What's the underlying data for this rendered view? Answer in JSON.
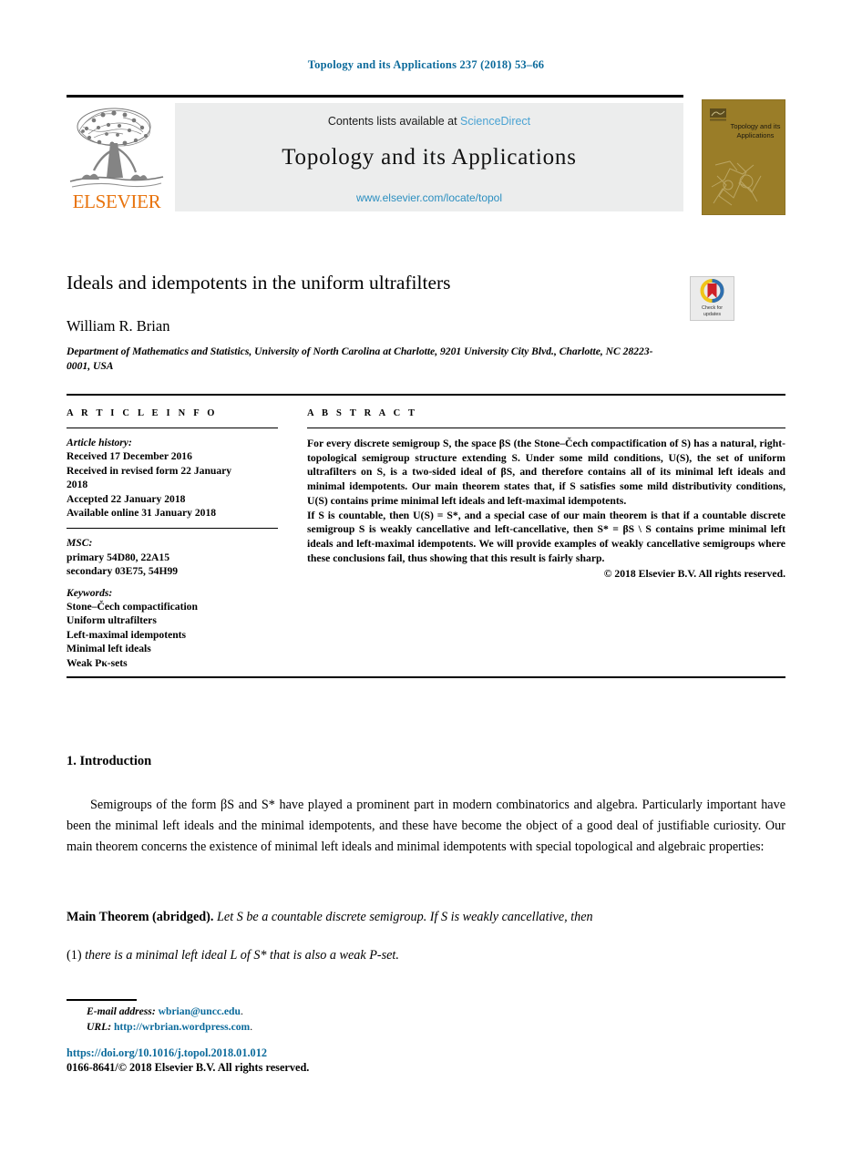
{
  "running_head": "Topology and its Applications 237 (2018) 53–66",
  "masthead": {
    "contents_prefix": "Contents lists available at ",
    "sciencedirect": "ScienceDirect",
    "journal_title": "Topology and its Applications",
    "journal_url": "www.elsevier.com/locate/topol",
    "publisher_wordmark": "ELSEVIER",
    "cover_title": "Topology and its Applications",
    "accent_link_color": "#4ba3d3",
    "elsevier_orange": "#e8730c",
    "cover_background": "#9a7d28"
  },
  "article": {
    "title": "Ideals and idempotents in the uniform ultrafilters",
    "author": "William R. Brian",
    "affiliation": "Department of Mathematics and Statistics, University of North Carolina at Charlotte, 9201 University City Blvd., Charlotte, NC 28223-0001, USA",
    "crossmark_label_line1": "Check for",
    "crossmark_label_line2": "updates"
  },
  "info": {
    "heading": "A R T I C L E   I N F O",
    "history_label": "Article history:",
    "history": [
      "Received 17 December 2016",
      "Received in revised form 22 January",
      "2018",
      "Accepted 22 January 2018",
      "Available online 31 January 2018"
    ],
    "msc_label": "MSC:",
    "msc": [
      "primary 54D80, 22A15",
      "secondary 03E75, 54H99"
    ],
    "keywords_label": "Keywords:",
    "keywords": [
      "Stone–Čech compactification",
      "Uniform ultrafilters",
      "Left-maximal idempotents",
      "Minimal left ideals",
      "Weak Pκ-sets"
    ]
  },
  "abstract": {
    "heading": "A B S T R A C T",
    "paragraph1": "For every discrete semigroup S, the space βS (the Stone–Čech compactification of S) has a natural, right-topological semigroup structure extending S. Under some mild conditions, U(S), the set of uniform ultrafilters on S, is a two-sided ideal of βS, and therefore contains all of its minimal left ideals and minimal idempotents. Our main theorem states that, if S satisfies some mild distributivity conditions, U(S) contains prime minimal left ideals and left-maximal idempotents.",
    "paragraph2": "If S is countable, then U(S) = S*, and a special case of our main theorem is that if a countable discrete semigroup S is weakly cancellative and left-cancellative, then S* = βS \\ S contains prime minimal left ideals and left-maximal idempotents. We will provide examples of weakly cancellative semigroups where these conclusions fail, thus showing that this result is fairly sharp.",
    "copyright": "© 2018 Elsevier B.V. All rights reserved."
  },
  "body": {
    "section_title": "1. Introduction",
    "paragraph": "Semigroups of the form βS and S* have played a prominent part in modern combinatorics and algebra. Particularly important have been the minimal left ideals and the minimal idempotents, and these have become the object of a good deal of justifiable curiosity. Our main theorem concerns the existence of minimal left ideals and minimal idempotents with special topological and algebraic properties:",
    "theorem_label": "Main Theorem (abridged).",
    "theorem_text": "Let S be a countable discrete semigroup. If S is weakly cancellative, then",
    "item_number": "(1)",
    "item_text": "there is a minimal left ideal L of S* that is also a weak P-set."
  },
  "footer": {
    "email_label": "E-mail address:",
    "email": "wbrian@uncc.edu",
    "url_label": "URL:",
    "url": "http://wrbrian.wordpress.com",
    "doi": "https://doi.org/10.1016/j.topol.2018.01.012",
    "issn_line": "0166-8641/© 2018 Elsevier B.V. All rights reserved.",
    "link_color": "#0b6a9b"
  }
}
